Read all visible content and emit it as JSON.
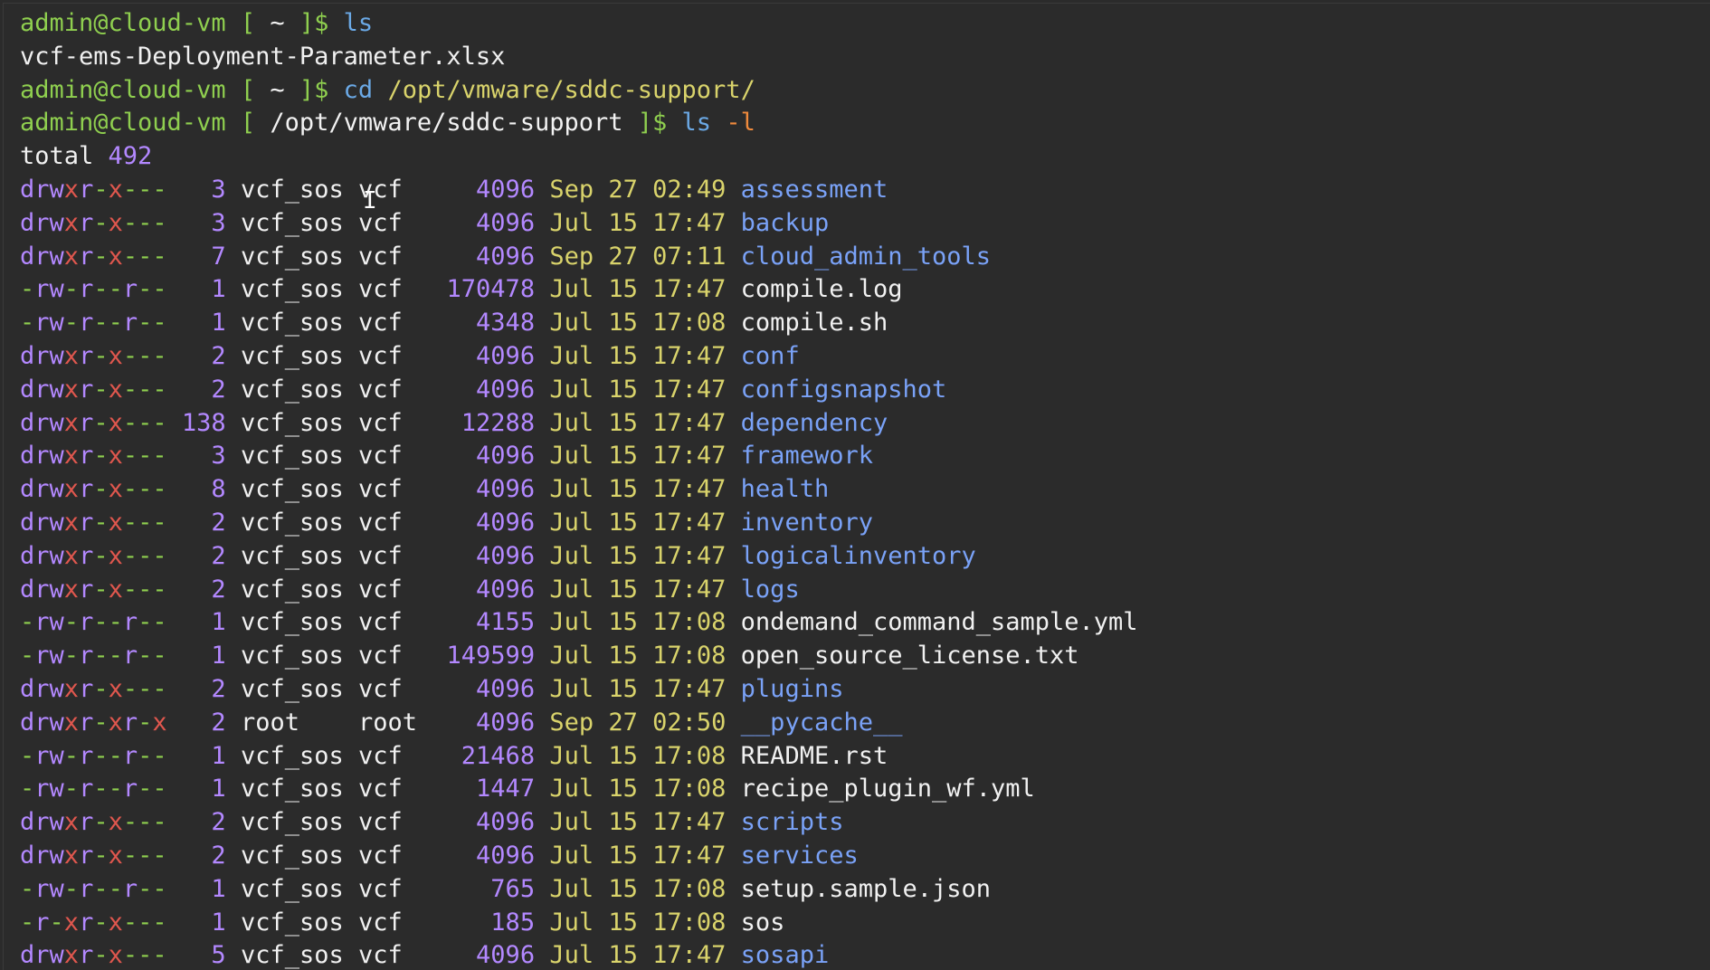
{
  "colors": {
    "background": "#2b2b2b",
    "prompt": "#8fcf4f",
    "command": "#6ba9e6",
    "argument": "#d9d36b",
    "option": "#f08a3c",
    "number": "#b388ff",
    "date": "#d9d36b",
    "directory": "#7aa2f7",
    "file": "#f1f1f1"
  },
  "session": [
    {
      "type": "prompt",
      "user": "admin@cloud-vm",
      "path": "~",
      "cmd": "ls",
      "arg": "",
      "opt": ""
    },
    {
      "type": "output",
      "text": "vcf-ems-Deployment-Parameter.xlsx"
    },
    {
      "type": "prompt",
      "user": "admin@cloud-vm",
      "path": "~",
      "cmd": "cd",
      "arg": "/opt/vmware/sddc-support/",
      "opt": ""
    },
    {
      "type": "prompt",
      "user": "admin@cloud-vm",
      "path": "/opt/vmware/sddc-support",
      "cmd": "ls",
      "arg": "",
      "opt": "-l"
    },
    {
      "type": "total",
      "label": "total",
      "value": "492"
    }
  ],
  "listing": [
    {
      "perm": "drwxr-x---",
      "links": "3",
      "owner": "vcf_sos",
      "group": "vcf",
      "size": "4096",
      "month": "Sep",
      "day": "27",
      "time": "02:49",
      "name": "assessment",
      "kind": "dir"
    },
    {
      "perm": "drwxr-x---",
      "links": "3",
      "owner": "vcf_sos",
      "group": "vcf",
      "size": "4096",
      "month": "Jul",
      "day": "15",
      "time": "17:47",
      "name": "backup",
      "kind": "dir"
    },
    {
      "perm": "drwxr-x---",
      "links": "7",
      "owner": "vcf_sos",
      "group": "vcf",
      "size": "4096",
      "month": "Sep",
      "day": "27",
      "time": "07:11",
      "name": "cloud_admin_tools",
      "kind": "dir"
    },
    {
      "perm": "-rw-r--r--",
      "links": "1",
      "owner": "vcf_sos",
      "group": "vcf",
      "size": "170478",
      "month": "Jul",
      "day": "15",
      "time": "17:47",
      "name": "compile.log",
      "kind": "file"
    },
    {
      "perm": "-rw-r--r--",
      "links": "1",
      "owner": "vcf_sos",
      "group": "vcf",
      "size": "4348",
      "month": "Jul",
      "day": "15",
      "time": "17:08",
      "name": "compile.sh",
      "kind": "file"
    },
    {
      "perm": "drwxr-x---",
      "links": "2",
      "owner": "vcf_sos",
      "group": "vcf",
      "size": "4096",
      "month": "Jul",
      "day": "15",
      "time": "17:47",
      "name": "conf",
      "kind": "dir"
    },
    {
      "perm": "drwxr-x---",
      "links": "2",
      "owner": "vcf_sos",
      "group": "vcf",
      "size": "4096",
      "month": "Jul",
      "day": "15",
      "time": "17:47",
      "name": "configsnapshot",
      "kind": "dir"
    },
    {
      "perm": "drwxr-x---",
      "links": "138",
      "owner": "vcf_sos",
      "group": "vcf",
      "size": "12288",
      "month": "Jul",
      "day": "15",
      "time": "17:47",
      "name": "dependency",
      "kind": "dir"
    },
    {
      "perm": "drwxr-x---",
      "links": "3",
      "owner": "vcf_sos",
      "group": "vcf",
      "size": "4096",
      "month": "Jul",
      "day": "15",
      "time": "17:47",
      "name": "framework",
      "kind": "dir"
    },
    {
      "perm": "drwxr-x---",
      "links": "8",
      "owner": "vcf_sos",
      "group": "vcf",
      "size": "4096",
      "month": "Jul",
      "day": "15",
      "time": "17:47",
      "name": "health",
      "kind": "dir"
    },
    {
      "perm": "drwxr-x---",
      "links": "2",
      "owner": "vcf_sos",
      "group": "vcf",
      "size": "4096",
      "month": "Jul",
      "day": "15",
      "time": "17:47",
      "name": "inventory",
      "kind": "dir"
    },
    {
      "perm": "drwxr-x---",
      "links": "2",
      "owner": "vcf_sos",
      "group": "vcf",
      "size": "4096",
      "month": "Jul",
      "day": "15",
      "time": "17:47",
      "name": "logicalinventory",
      "kind": "dir"
    },
    {
      "perm": "drwxr-x---",
      "links": "2",
      "owner": "vcf_sos",
      "group": "vcf",
      "size": "4096",
      "month": "Jul",
      "day": "15",
      "time": "17:47",
      "name": "logs",
      "kind": "dir"
    },
    {
      "perm": "-rw-r--r--",
      "links": "1",
      "owner": "vcf_sos",
      "group": "vcf",
      "size": "4155",
      "month": "Jul",
      "day": "15",
      "time": "17:08",
      "name": "ondemand_command_sample.yml",
      "kind": "file"
    },
    {
      "perm": "-rw-r--r--",
      "links": "1",
      "owner": "vcf_sos",
      "group": "vcf",
      "size": "149599",
      "month": "Jul",
      "day": "15",
      "time": "17:08",
      "name": "open_source_license.txt",
      "kind": "file"
    },
    {
      "perm": "drwxr-x---",
      "links": "2",
      "owner": "vcf_sos",
      "group": "vcf",
      "size": "4096",
      "month": "Jul",
      "day": "15",
      "time": "17:47",
      "name": "plugins",
      "kind": "dir"
    },
    {
      "perm": "drwxr-xr-x",
      "links": "2",
      "owner": "root",
      "group": "root",
      "size": "4096",
      "month": "Sep",
      "day": "27",
      "time": "02:50",
      "name": "__pycache__",
      "kind": "dir"
    },
    {
      "perm": "-rw-r--r--",
      "links": "1",
      "owner": "vcf_sos",
      "group": "vcf",
      "size": "21468",
      "month": "Jul",
      "day": "15",
      "time": "17:08",
      "name": "README.rst",
      "kind": "file"
    },
    {
      "perm": "-rw-r--r--",
      "links": "1",
      "owner": "vcf_sos",
      "group": "vcf",
      "size": "1447",
      "month": "Jul",
      "day": "15",
      "time": "17:08",
      "name": "recipe_plugin_wf.yml",
      "kind": "file"
    },
    {
      "perm": "drwxr-x---",
      "links": "2",
      "owner": "vcf_sos",
      "group": "vcf",
      "size": "4096",
      "month": "Jul",
      "day": "15",
      "time": "17:47",
      "name": "scripts",
      "kind": "dir"
    },
    {
      "perm": "drwxr-x---",
      "links": "2",
      "owner": "vcf_sos",
      "group": "vcf",
      "size": "4096",
      "month": "Jul",
      "day": "15",
      "time": "17:47",
      "name": "services",
      "kind": "dir"
    },
    {
      "perm": "-rw-r--r--",
      "links": "1",
      "owner": "vcf_sos",
      "group": "vcf",
      "size": "765",
      "month": "Jul",
      "day": "15",
      "time": "17:08",
      "name": "setup.sample.json",
      "kind": "file"
    },
    {
      "perm": "-r-xr-x---",
      "links": "1",
      "owner": "vcf_sos",
      "group": "vcf",
      "size": "185",
      "month": "Jul",
      "day": "15",
      "time": "17:08",
      "name": "sos",
      "kind": "file"
    },
    {
      "perm": "drwxr-x---",
      "links": "5",
      "owner": "vcf_sos",
      "group": "vcf",
      "size": "4096",
      "month": "Jul",
      "day": "15",
      "time": "17:47",
      "name": "sosapi",
      "kind": "dir"
    }
  ],
  "cursor": {
    "icon": "text-cursor-ibeam-icon",
    "glyph": "I"
  }
}
